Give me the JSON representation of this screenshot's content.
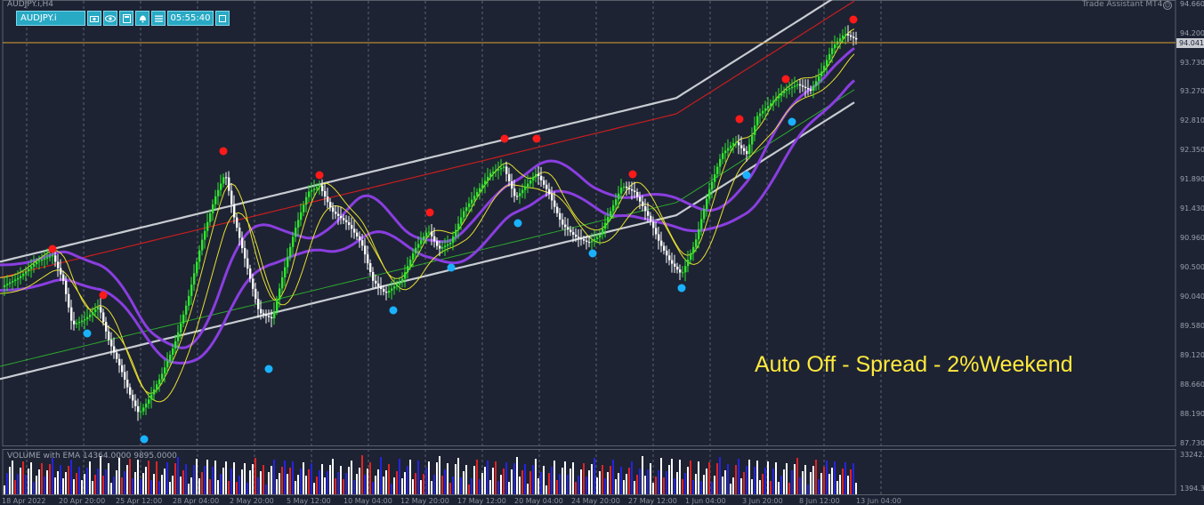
{
  "window": {
    "title": "AUDJPY.i,H4"
  },
  "toolbar": {
    "symbol": "AUDJPY.i",
    "icons": [
      "camera-icon",
      "eye-icon",
      "calculator-icon",
      "bell-icon",
      "menu-icon"
    ],
    "time": "05:55:40",
    "end_icon": "square-icon"
  },
  "plugin": {
    "label": "Trade Assistant MT4"
  },
  "annotation": "Auto Off - Spread - 2%Weekend",
  "price_axis": {
    "labels": [
      "94.660",
      "94.200",
      "93.730",
      "93.270",
      "92.810",
      "92.350",
      "91.890",
      "91.430",
      "90.960",
      "90.500",
      "90.040",
      "89.580",
      "89.120",
      "88.660",
      "88.190",
      "87.730"
    ],
    "current_price": "94.041"
  },
  "volume_panel": {
    "title": "VOLUME with EMA 14364.0000 9895.0000",
    "axis_labels": [
      "33242.",
      "1394.3"
    ]
  },
  "time_axis": {
    "labels": [
      "18 Apr 2022",
      "20 Apr 20:00",
      "25 Apr 12:00",
      "28 Apr 04:00",
      "2 May 20:00",
      "5 May 12:00",
      "10 May 04:00",
      "12 May 20:00",
      "17 May 12:00",
      "20 May 04:00",
      "24 May 20:00",
      "27 May 12:00",
      "1 Jun 04:00",
      "3 Jun 20:00",
      "8 Jun 12:00",
      "13 Jun 04:00"
    ]
  },
  "colors": {
    "background": "#1d2333",
    "bull_candle": "#2ee62e",
    "bear_candle": "#ffffff",
    "current_price_line": "#e0a030",
    "band": "#c8ccd2",
    "ma_red": "#c81e1e",
    "ma_purple": "#8a3ee0",
    "ma_yellow": "#e8e030",
    "ma_green": "#2ea82e",
    "swing_high_dot": "#ff1a1a",
    "swing_low_dot": "#1ab2ff",
    "volume_white": "#ffffff",
    "volume_red": "#e02424",
    "volume_blue": "#2424e0",
    "annotation": "#ffe93d"
  }
}
